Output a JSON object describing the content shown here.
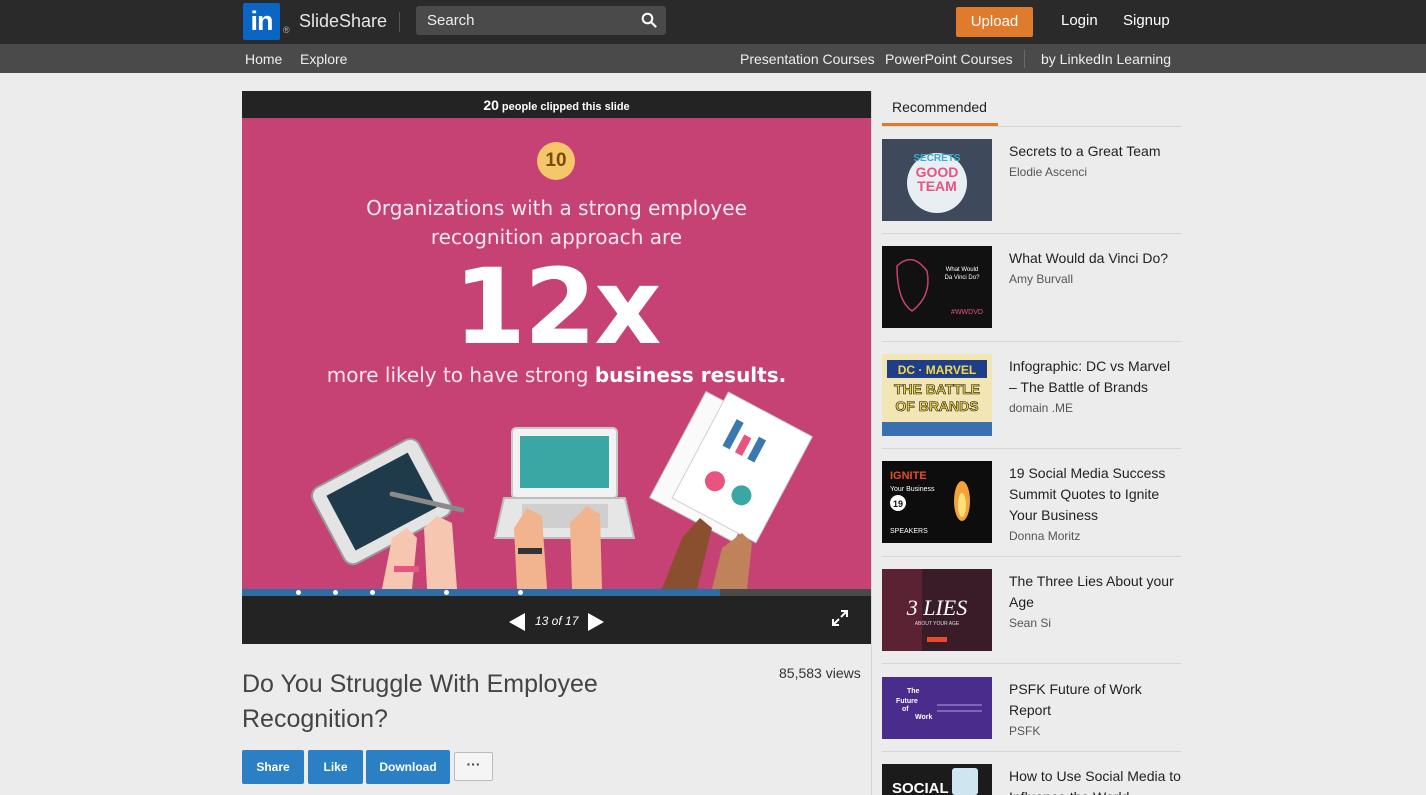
{
  "header": {
    "logo_mark": "in",
    "logo_reg": "®",
    "brand": "SlideShare",
    "search_placeholder": "Search",
    "upload_label": "Upload",
    "login_label": "Login",
    "signup_label": "Signup"
  },
  "subnav": {
    "home": "Home",
    "explore": "Explore",
    "presentation_courses": "Presentation Courses",
    "powerpoint_courses": "PowerPoint Courses",
    "linkedin_learning": "by LinkedIn Learning"
  },
  "player": {
    "clip_count": "20",
    "clip_text": "people clipped this slide",
    "page_indicator": "13 of 17",
    "progress_fraction": 0.76,
    "slide": {
      "badge": "10",
      "line1": "Organizations with a strong employee",
      "line2": "recognition approach are",
      "big": "12x",
      "line3_plain": "more likely to have strong ",
      "line3_bold": "business results."
    }
  },
  "presentation": {
    "title": "Do You Struggle With Employee Recognition?",
    "views": "85,583 views",
    "share_label": "Share",
    "like_label": "Like",
    "download_label": "Download",
    "more_label": "···"
  },
  "recommended": {
    "heading": "Recommended",
    "items": [
      {
        "title": "Secrets to a Great Team",
        "author": "Elodie Ascenci",
        "thumb_text": "SECRETS GOOD TEAM"
      },
      {
        "title": "What Would da Vinci Do?",
        "author": "Amy Burvall",
        "thumb_text": "What Would Da Vinci Do?"
      },
      {
        "title": "Infographic: DC vs Marvel – The Battle of Brands",
        "author": "domain .ME",
        "thumb_text": "DC MARVEL THE BATTLE OF BRANDS"
      },
      {
        "title": "19 Social Media Success Summit Quotes to Ignite Your Business",
        "author": "Donna Moritz",
        "thumb_text": "IGNITE Your Business"
      },
      {
        "title": "The Three Lies About your Age",
        "author": "Sean Si",
        "thumb_text": "3 LIES"
      },
      {
        "title": "PSFK Future of Work Report",
        "author": "PSFK",
        "thumb_text": "The Future of Work"
      },
      {
        "title": "How to Use Social Media to Influence the World",
        "author": "",
        "thumb_text": "SOCIAL"
      }
    ]
  }
}
